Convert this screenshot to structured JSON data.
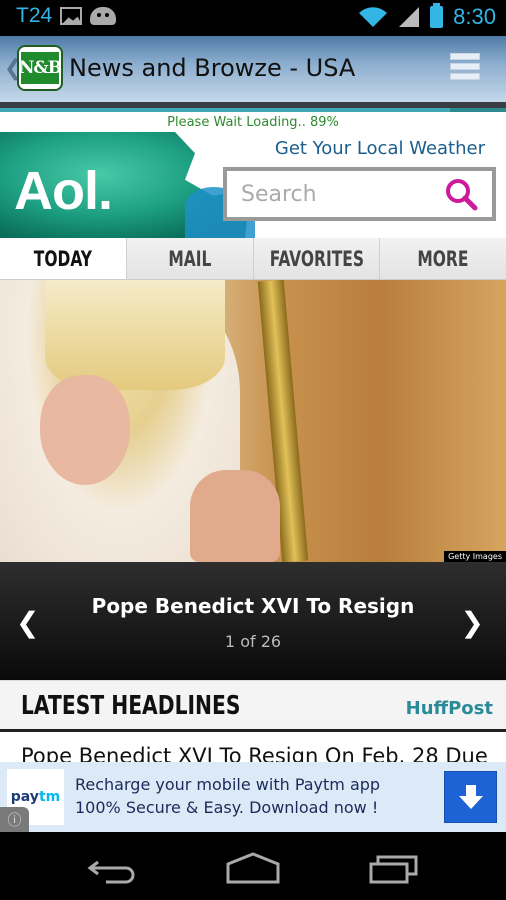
{
  "status_bar": {
    "carrier": "T24",
    "time": "8:30",
    "icons": [
      "image-icon",
      "android-icon",
      "wifi-icon",
      "signal-icon",
      "battery-charging-icon"
    ]
  },
  "app_bar": {
    "title": "News and Browze - USA",
    "logo_text": "N&B",
    "back_glyph": "❮",
    "menu_icon": "menu-list-icon"
  },
  "loading": {
    "text": "Please Wait Loading.. 89%",
    "progress_percent": 89
  },
  "aol": {
    "logo": "Aol.",
    "weather_link": "Get Your Local Weather",
    "search_placeholder": "Search",
    "search_value": "",
    "tabs": [
      {
        "label": "TODAY",
        "active": true
      },
      {
        "label": "MAIL",
        "active": false
      },
      {
        "label": "FAVORITES",
        "active": false
      },
      {
        "label": "MORE",
        "active": false
      }
    ]
  },
  "hero": {
    "credit": "Getty Images",
    "title": "Pope Benedict XVI To Resign",
    "counter": "1 of 26",
    "prev_glyph": "❮",
    "next_glyph": "❯"
  },
  "headlines": {
    "section_title": "LATEST HEADLINES",
    "source_link": "HuffPost",
    "items": [
      "Pope Benedict XVI To Resign On Feb. 28 Due"
    ]
  },
  "ad": {
    "logo_main": "pay",
    "logo_accent": "tm",
    "line1": "Recharge your mobile with Paytm app",
    "line2": "100% Secure & Easy. Download now !",
    "info_glyph": "ⓘ"
  },
  "colors": {
    "status_accent": "#33b5e5",
    "loading_text": "#2d8a2d",
    "weather_link": "#1b5e8c",
    "search_icon": "#cc1a9a",
    "huffpost": "#2a8a9a",
    "ad_button": "#1e63d6"
  }
}
